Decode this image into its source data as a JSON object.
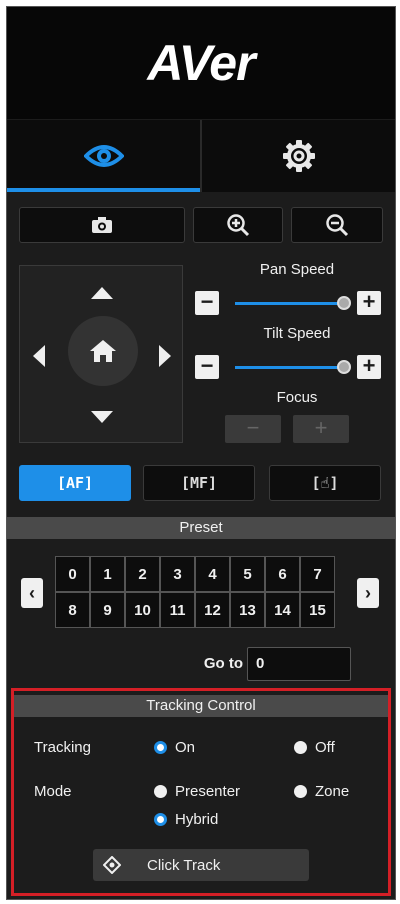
{
  "header": {
    "logo": "AVer"
  },
  "tabs": [
    {
      "icon": "eye-icon",
      "active": true
    },
    {
      "icon": "gear-icon",
      "active": false
    }
  ],
  "toolbar": {
    "icons": [
      "camera-icon",
      "zoom-in-icon",
      "zoom-out-icon"
    ]
  },
  "ptz": {
    "pan_speed_label": "Pan Speed",
    "pan_speed_value": 0.95,
    "tilt_speed_label": "Tilt Speed",
    "tilt_speed_value": 0.95,
    "focus_label": "Focus",
    "minus": "−",
    "plus": "+"
  },
  "focus_modes": [
    {
      "label": "[AF]",
      "active": true
    },
    {
      "label": "[MF]",
      "active": false
    },
    {
      "label": "[☝]",
      "active": false
    }
  ],
  "preset": {
    "title": "Preset",
    "numbers": [
      "0",
      "1",
      "2",
      "3",
      "4",
      "5",
      "6",
      "7",
      "8",
      "9",
      "10",
      "11",
      "12",
      "13",
      "14",
      "15"
    ],
    "prev": "‹",
    "next": "›",
    "goto_label": "Go to",
    "goto_value": "0"
  },
  "tracking": {
    "title": "Tracking Control",
    "tracking_label": "Tracking",
    "on": "On",
    "off": "Off",
    "tracking_selected": "On",
    "mode_label": "Mode",
    "presenter": "Presenter",
    "zone": "Zone",
    "hybrid": "Hybrid",
    "mode_selected": "Hybrid",
    "click_track": "Click Track"
  },
  "colors": {
    "accent": "#1e8fe8",
    "highlight_border": "#d41f26"
  }
}
